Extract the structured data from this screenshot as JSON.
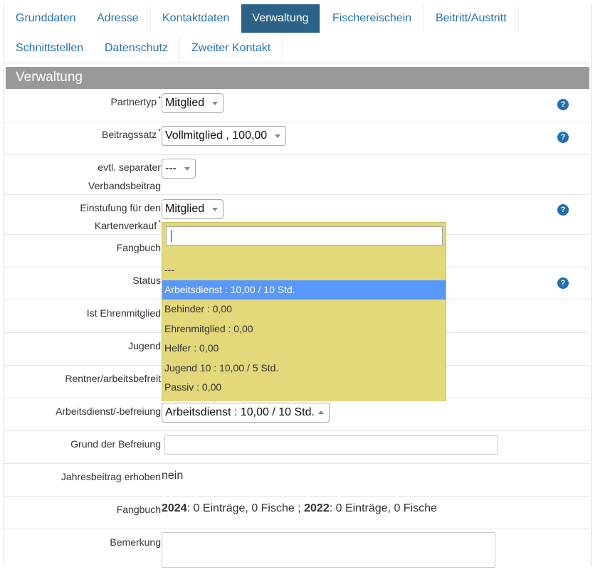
{
  "tabs": [
    "Grunddaten",
    "Adresse",
    "Kontaktdaten",
    "Verwaltung",
    "Fischereischein",
    "Beitritt/Austritt",
    "Schnittstellen",
    "Datenschutz",
    "Zweiter Kontakt"
  ],
  "section_title": "Verwaltung",
  "required_mark": "*",
  "help_glyph": "?",
  "fields": {
    "partnertyp": {
      "label": "Partnertyp",
      "value": "Mitglied"
    },
    "beitragssatz": {
      "label": "Beitragssatz",
      "value": "Vollmitglied , 100,00"
    },
    "verbandsbeitrag": {
      "label_line1": "evtl. separater",
      "label_line2": "Verbandsbeitrag",
      "value": "---"
    },
    "einstufung": {
      "label_line1": "Einstufung für den",
      "label_line2": "Kartenverkauf",
      "value": "Mitglied"
    },
    "fangbuch_select": {
      "label": "Fangbuch"
    },
    "status": {
      "label": "Status"
    },
    "ehrenmitglied": {
      "label": "Ist Ehrenmitglied"
    },
    "jugend": {
      "label": "Jugend"
    },
    "rentner": {
      "label": "Rentner/arbeitsbefreit"
    },
    "arbeitsdienst": {
      "label": "Arbeitsdienst/-befreiung",
      "value": "Arbeitsdienst : 10,00 / 10 Std."
    },
    "grund": {
      "label": "Grund der Befreiung",
      "value": ""
    },
    "jahresbeitrag": {
      "label": "Jahresbeitrag erhoben",
      "value": "nein"
    },
    "fangbuch": {
      "label": "Fangbuch",
      "year1": "2024",
      "text1": ": 0 Einträge, 0 Fische ; ",
      "year2": "2022",
      "text2": ": 0 Einträge, 0 Fische"
    },
    "bemerkung": {
      "label": "Bemerkung",
      "value": ""
    }
  },
  "dropdown": {
    "search_value": "",
    "options": [
      "---",
      "Arbeitsdienst : 10,00 / 10 Std.",
      "Behinder : 0,00",
      "Ehrenmitglied : 0,00",
      "Helfer : 0,00",
      "Jugend 10 : 10,00 / 5 Std.",
      "Passiv : 0,00"
    ],
    "highlighted": "Arbeitsdienst : 10,00 / 10 Std."
  },
  "colors": {
    "tab_active_bg": "#2c6287",
    "link": "#2574b5",
    "header_bg": "#999999",
    "dropdown_bg": "#e3d87a",
    "highlight": "#5897fb",
    "help": "#1f6fb4"
  }
}
